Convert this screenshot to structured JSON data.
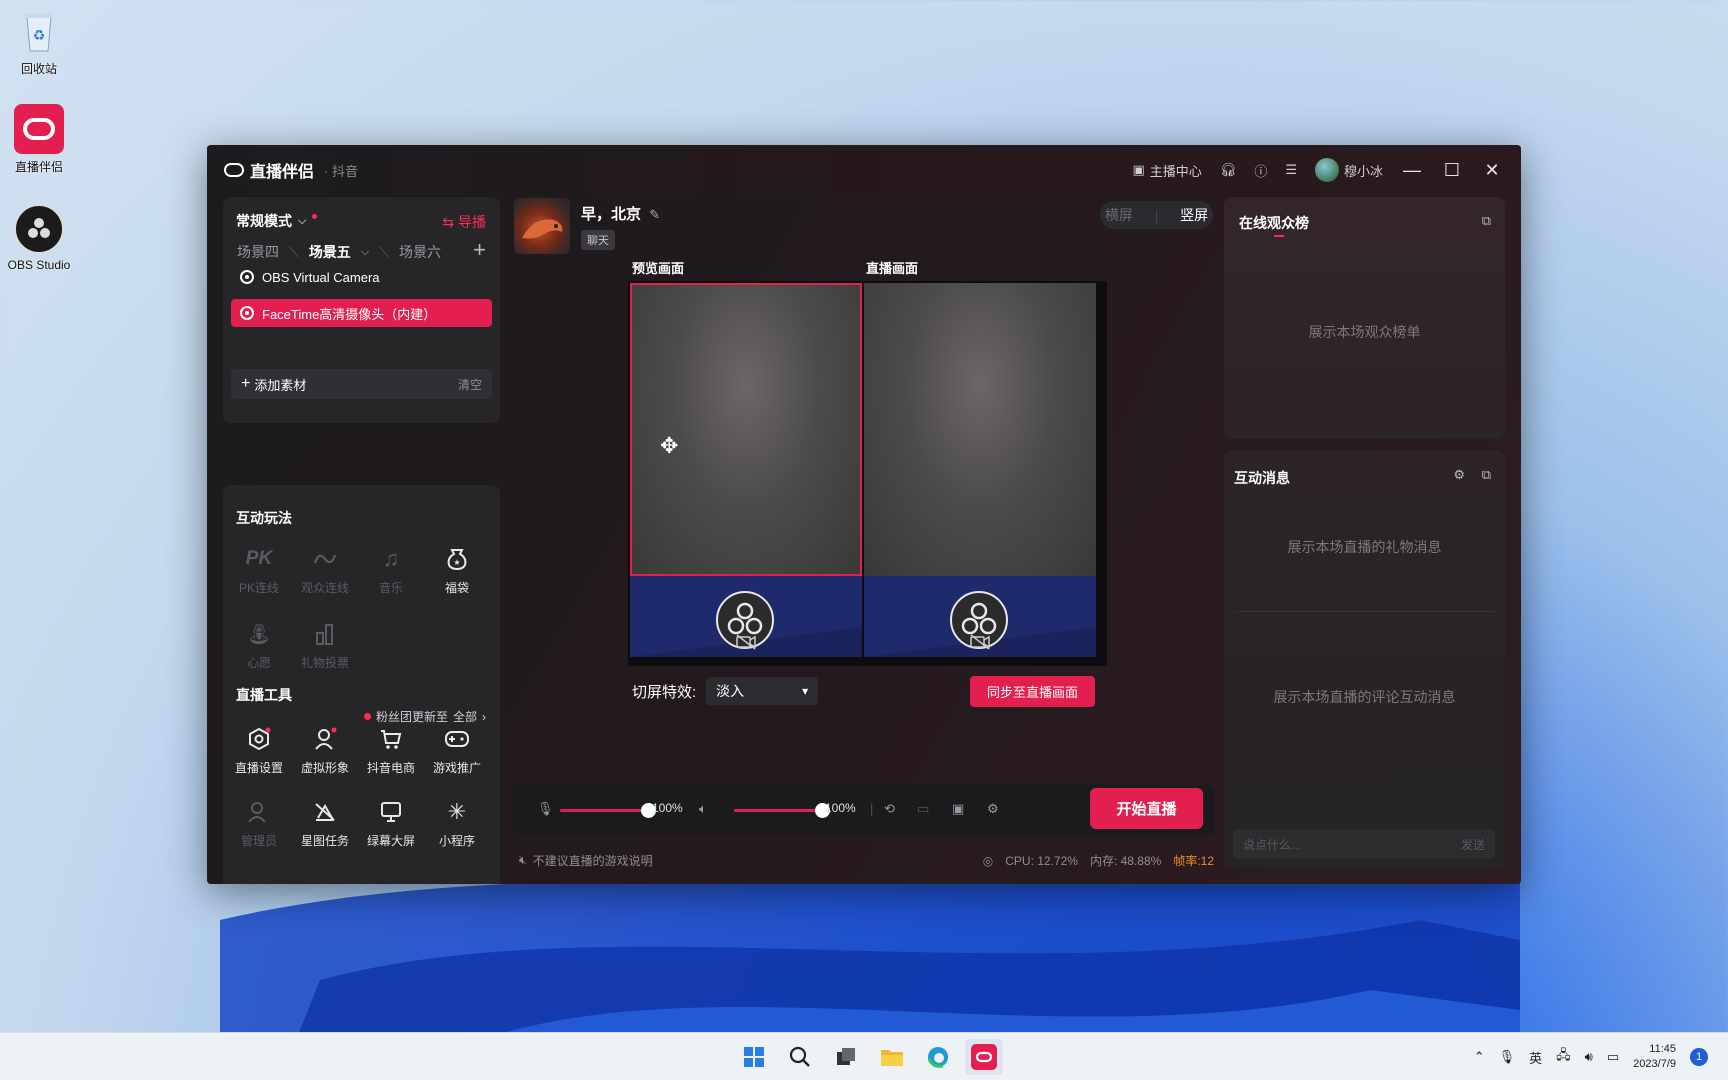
{
  "desktop": {
    "icons": [
      {
        "label": "回收站",
        "icon": "recycle-bin-icon"
      },
      {
        "label": "直播伴侣",
        "icon": "live-companion-icon"
      },
      {
        "label": "OBS Studio",
        "icon": "obs-icon"
      }
    ]
  },
  "window": {
    "app_name": "直播伴侣",
    "platform": "· 抖音",
    "host_center": "主播中心",
    "user_name": "穆小冰"
  },
  "scene_panel": {
    "mode": "常规模式",
    "guide": "导播",
    "scenes": [
      "场景四",
      "场景五",
      "场景六"
    ],
    "active_scene": "场景五",
    "sources": [
      {
        "label": "OBS Virtual Camera",
        "selected": false
      },
      {
        "label": "FaceTime高清摄像头（内建）",
        "selected": true
      }
    ],
    "add_material": "添加素材",
    "clear": "清空"
  },
  "interaction": {
    "title": "互动玩法",
    "items": [
      {
        "label": "PK连线",
        "icon": "pk-icon",
        "enabled": false
      },
      {
        "label": "观众连线",
        "icon": "audience-link-icon",
        "enabled": false
      },
      {
        "label": "音乐",
        "icon": "music-icon",
        "enabled": false
      },
      {
        "label": "福袋",
        "icon": "lucky-bag-icon",
        "enabled": true
      },
      {
        "label": "心愿",
        "icon": "wish-icon",
        "enabled": false
      },
      {
        "label": "礼物投票",
        "icon": "gift-vote-icon",
        "enabled": false
      }
    ]
  },
  "live_tools": {
    "title": "直播工具",
    "fan_note": "粉丝团更新至",
    "all": "全部",
    "items": [
      {
        "label": "直播设置",
        "icon": "live-settings-icon",
        "enabled": true
      },
      {
        "label": "虚拟形象",
        "icon": "avatar-icon",
        "enabled": true
      },
      {
        "label": "抖音电商",
        "icon": "cart-icon",
        "enabled": true
      },
      {
        "label": "游戏推广",
        "icon": "gamepad-icon",
        "enabled": true
      },
      {
        "label": "管理员",
        "icon": "admin-icon",
        "enabled": false
      },
      {
        "label": "星图任务",
        "icon": "star-task-icon",
        "enabled": true
      },
      {
        "label": "绿幕大屏",
        "icon": "green-screen-icon",
        "enabled": true
      },
      {
        "label": "小程序",
        "icon": "mini-program-icon",
        "enabled": true
      }
    ]
  },
  "center": {
    "greeting": "早，北京",
    "tag": "聊天",
    "orientation": {
      "landscape": "横屏",
      "portrait": "竖屏",
      "active": "portrait"
    },
    "preview_label": "预览画面",
    "live_label": "直播画面",
    "switch_effect_label": "切屏特效:",
    "switch_effect_value": "淡入",
    "sync_button": "同步至直播画面",
    "mic_volume": "100%",
    "speaker_volume": "100%",
    "mic_level": 1.0,
    "speaker_level": 1.0,
    "start_button": "开始直播",
    "game_note": "不建议直播的游戏说明",
    "cpu": "CPU: 12.72%",
    "memory": "内存: 48.88%",
    "fps": "帧率:12"
  },
  "right": {
    "audience_title": "在线观众榜",
    "audience_placeholder": "展示本场观众榜单",
    "messages_title": "互动消息",
    "gift_placeholder": "展示本场直播的礼物消息",
    "comment_placeholder": "展示本场直播的评论互动消息",
    "input_placeholder": "说点什么...",
    "send": "发送"
  },
  "taskbar": {
    "ime": "英",
    "time": "11:45",
    "date": "2023/7/9",
    "notifications": "1"
  },
  "colors": {
    "accent": "#e21f4e",
    "brand": "#fe2c55"
  }
}
